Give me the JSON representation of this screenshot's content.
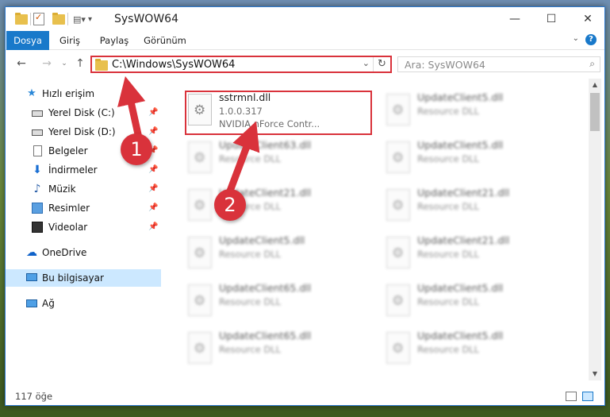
{
  "window": {
    "title": "SysWOW64"
  },
  "ribbon": {
    "tabs": [
      {
        "label": "Dosya"
      },
      {
        "label": "Giriş"
      },
      {
        "label": "Paylaş"
      },
      {
        "label": "Görünüm"
      }
    ],
    "help": "?"
  },
  "nav": {
    "address": "C:\\Windows\\SysWOW64",
    "search_placeholder": "Ara: SysWOW64"
  },
  "sidebar": {
    "items": [
      {
        "label": "Hızlı erişim",
        "icon": "star-icon"
      },
      {
        "label": "Yerel Disk (C:)",
        "icon": "disk-icon",
        "pinned": true
      },
      {
        "label": "Yerel Disk (D:)",
        "icon": "disk-icon",
        "pinned": true
      },
      {
        "label": "Belgeler",
        "icon": "documents-icon",
        "pinned": true
      },
      {
        "label": "İndirmeler",
        "icon": "download-icon",
        "pinned": true
      },
      {
        "label": "Müzik",
        "icon": "music-icon",
        "pinned": true
      },
      {
        "label": "Resimler",
        "icon": "pictures-icon",
        "pinned": true
      },
      {
        "label": "Videolar",
        "icon": "videos-icon",
        "pinned": true
      },
      {
        "label": "OneDrive",
        "icon": "onedrive-icon"
      },
      {
        "label": "Bu bilgisayar",
        "icon": "this-pc-icon",
        "selected": true
      },
      {
        "label": "Ağ",
        "icon": "network-icon"
      }
    ]
  },
  "files": [
    {
      "name": "sstrmnl.dll",
      "version": "1.0.0.317",
      "description": "NVIDIA nForce Contr...",
      "highlighted": true
    },
    {
      "name": "UpdateClient5.dll",
      "description": "Resource DLL"
    },
    {
      "name": "UpdateClient63.dll",
      "description": "Resource DLL"
    },
    {
      "name": "UpdateClient5.dll",
      "description": "Resource DLL"
    },
    {
      "name": "UpdateClient21.dll",
      "description": "Resource DLL"
    },
    {
      "name": "UpdateClient21.dll",
      "description": "Resource DLL"
    },
    {
      "name": "UpdateClient5.dll",
      "description": "Resource DLL"
    },
    {
      "name": "UpdateClient21.dll",
      "description": "Resource DLL"
    },
    {
      "name": "UpdateClient65.dll",
      "description": "Resource DLL"
    },
    {
      "name": "UpdateClient5.dll",
      "description": "Resource DLL"
    },
    {
      "name": "UpdateClient65.dll",
      "description": "Resource DLL"
    },
    {
      "name": "UpdateClient5.dll",
      "description": "Resource DLL"
    }
  ],
  "status": {
    "item_count": "117 öğe"
  },
  "annotations": {
    "badge1": "1",
    "badge2": "2",
    "color": "#d9323b"
  }
}
